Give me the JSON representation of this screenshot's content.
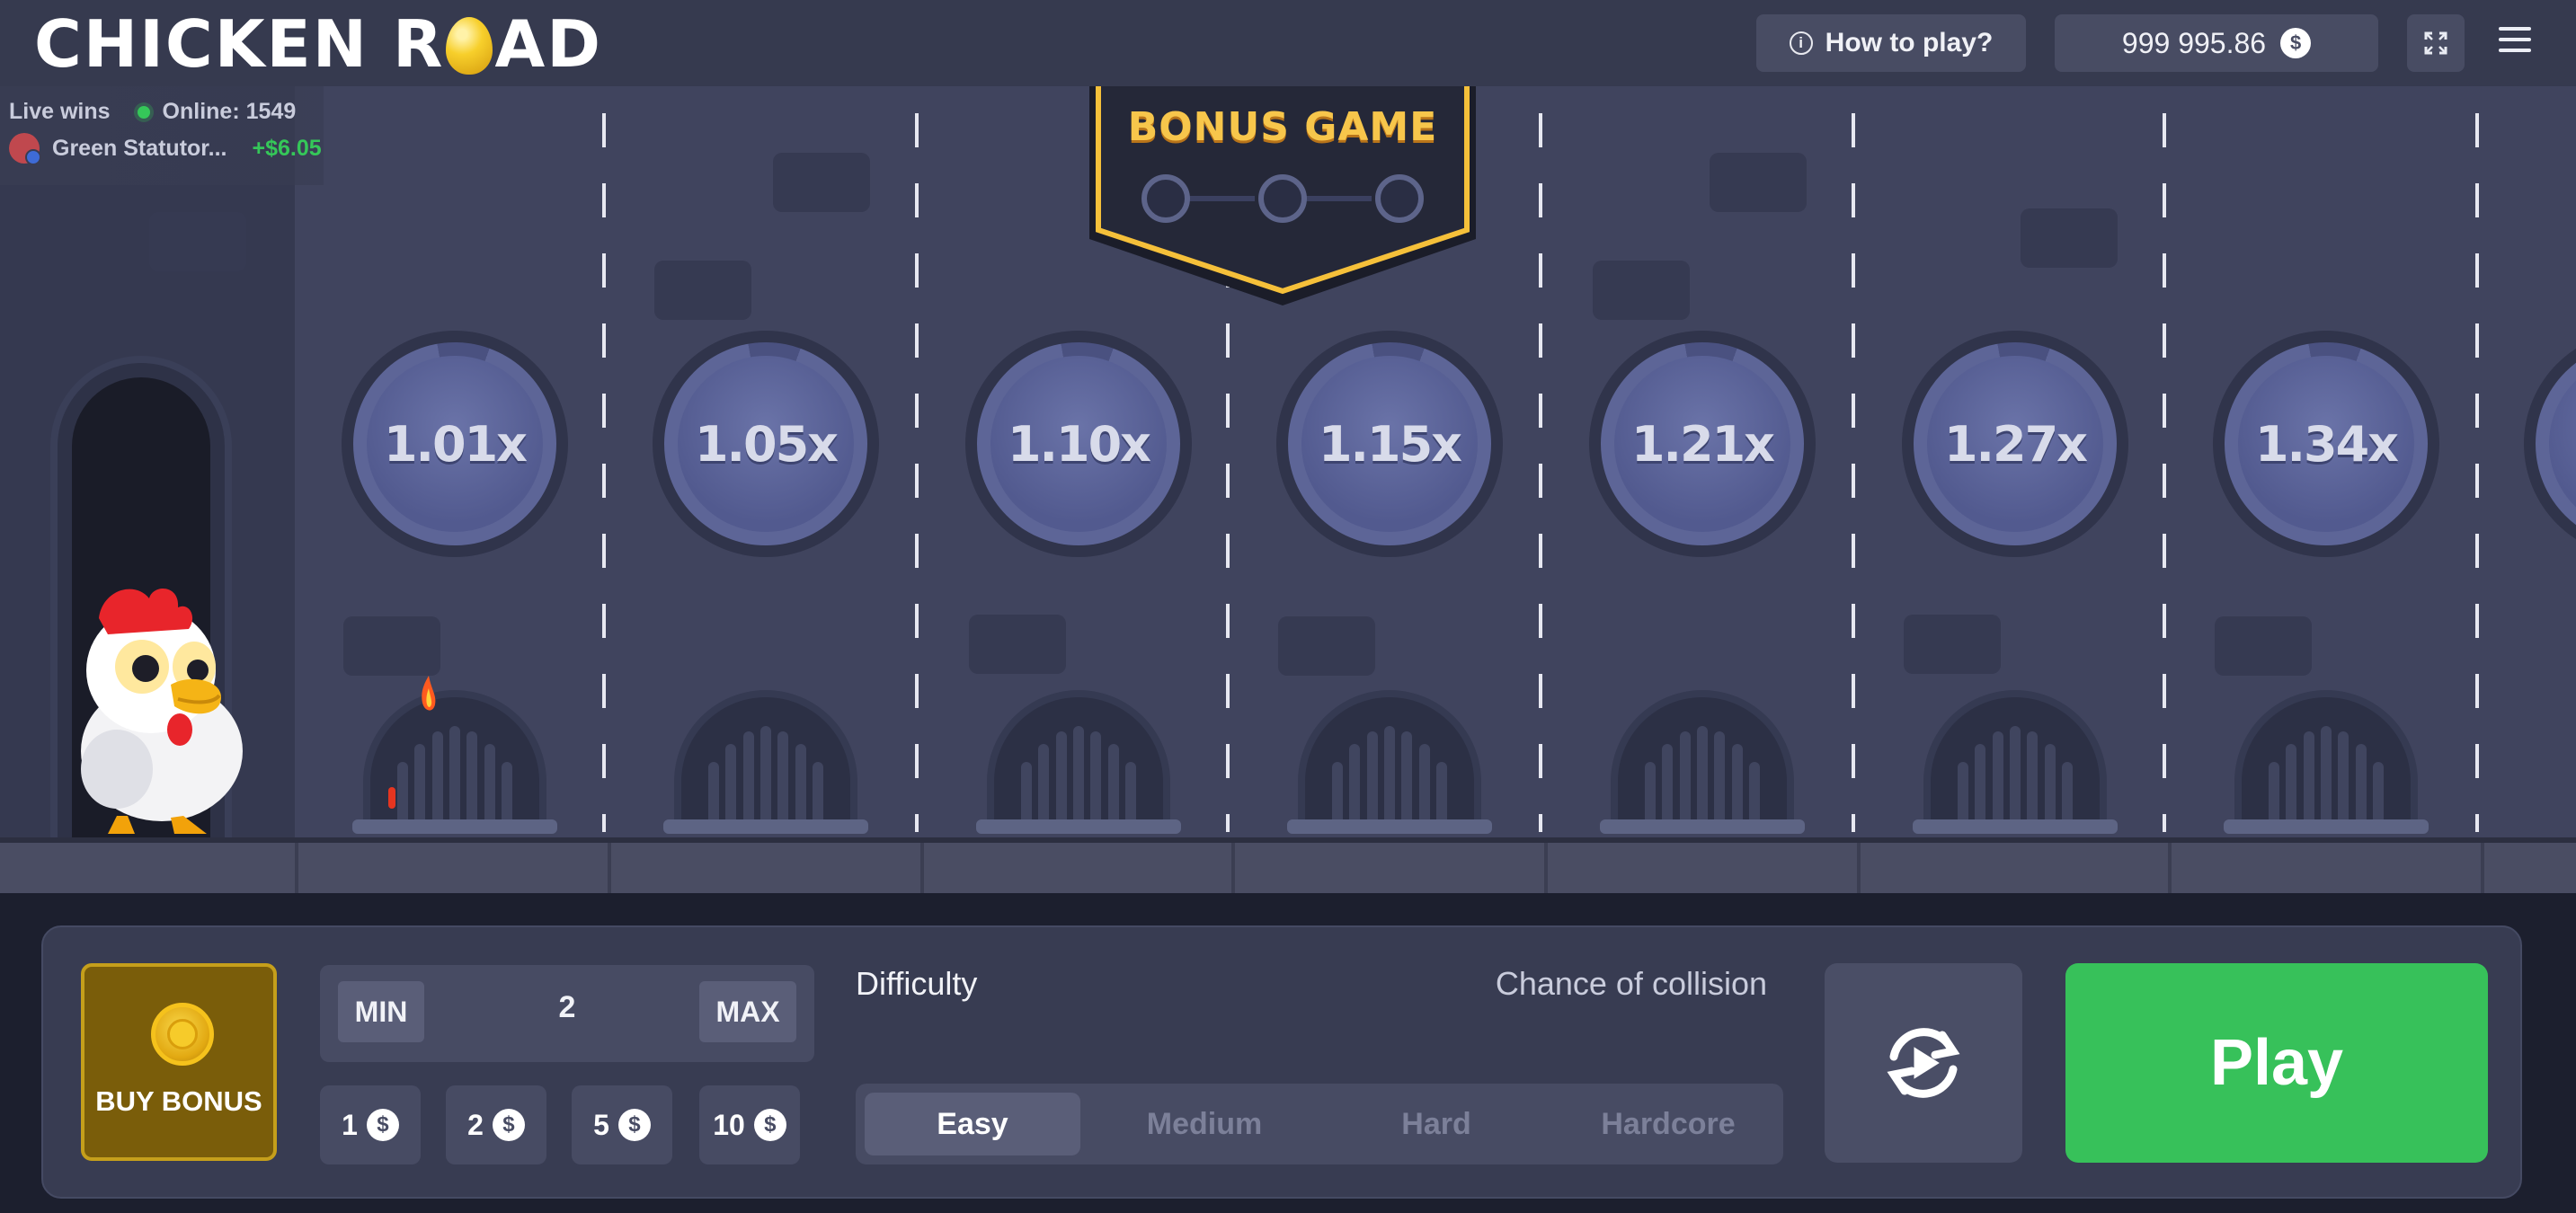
{
  "header": {
    "logo_part1": "CHICKEN R",
    "logo_part2": "AD",
    "how_to_play": "How to play?",
    "balance": "999 995.86",
    "currency_symbol": "$"
  },
  "live_wins": {
    "label": "Live wins",
    "online": "Online: 1549",
    "player": "Green Statutor...",
    "amount": "+$6.05"
  },
  "bonus_banner": {
    "title": "BONUS GAME",
    "nodes": 3
  },
  "lanes": {
    "multipliers": [
      "1.01x",
      "1.05x",
      "1.10x",
      "1.15x",
      "1.21x",
      "1.27x",
      "1.34x"
    ]
  },
  "controls": {
    "buy_bonus": "BUY BONUS",
    "min_label": "MIN",
    "max_label": "MAX",
    "bet_value": "2",
    "quick_bets": [
      "1",
      "2",
      "5",
      "10"
    ],
    "difficulty_label": "Difficulty",
    "chance_label": "Chance of collision",
    "difficulties": [
      "Easy",
      "Medium",
      "Hard",
      "Hardcore"
    ],
    "active_difficulty": "Easy",
    "play_label": "Play"
  },
  "colors": {
    "accent_green": "#37c15a",
    "bonus_gold": "#f7c64b",
    "panel": "#383c52",
    "game_bg": "#40445e"
  }
}
